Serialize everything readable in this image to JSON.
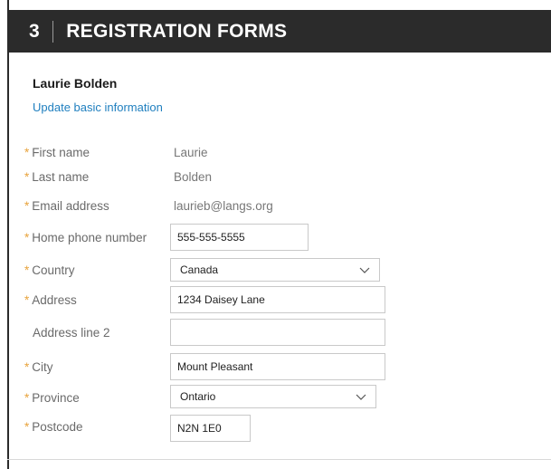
{
  "header": {
    "step": "3",
    "title": "REGISTRATION FORMS"
  },
  "user": {
    "name": "Laurie Bolden",
    "update_link": "Update basic information"
  },
  "form": {
    "first_name": {
      "label": "First name",
      "value": "Laurie",
      "required": true
    },
    "last_name": {
      "label": "Last name",
      "value": "Bolden",
      "required": true
    },
    "email": {
      "label": "Email address",
      "value": "laurieb@langs.org",
      "required": true
    },
    "home_phone": {
      "label": "Home phone number",
      "value": "555-555-5555",
      "required": true
    },
    "country": {
      "label": "Country",
      "value": "Canada",
      "required": true
    },
    "address": {
      "label": "Address",
      "value": "1234 Daisey Lane",
      "required": true
    },
    "address2": {
      "label": "Address line 2",
      "value": "",
      "required": false
    },
    "city": {
      "label": "City",
      "value": "Mount Pleasant",
      "required": true
    },
    "province": {
      "label": "Province",
      "value": "Ontario",
      "required": true
    },
    "postcode": {
      "label": "Postcode",
      "value": "N2N 1E0",
      "required": true
    }
  },
  "required_marker": "*",
  "colors": {
    "header_bg": "#2b2b2b",
    "link": "#1f7fbf",
    "required": "#e8a33c",
    "label": "#6a6a6a"
  },
  "icons": {
    "select_arrow": "chevron-down-icon"
  }
}
